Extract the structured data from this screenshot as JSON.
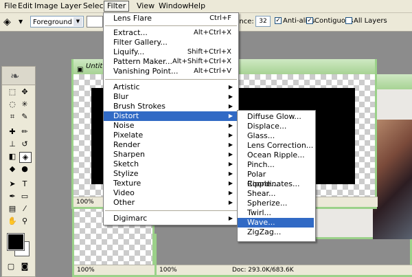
{
  "menubar": {
    "items": [
      "File",
      "Edit",
      "Image",
      "Layer",
      "Select",
      "Filter",
      "View",
      "Window",
      "Help"
    ],
    "active": "Filter"
  },
  "options": {
    "fill_source": "Foreground",
    "tolerance_label": "erance:",
    "tolerance_value": "32",
    "anti_alias_label": "Anti-alias",
    "anti_alias_checked": true,
    "contiguous_label": "Contiguous",
    "contiguous_checked": true,
    "all_layers_label": "All Layers",
    "all_layers_checked": false
  },
  "windows": {
    "doc1_title": "Untit",
    "doc1_zoom": "100%",
    "doc2_zoom": "100%",
    "doc3_zoom": "100%",
    "doc_size": "Doc: 293.0K/683.6K"
  },
  "filter_menu": {
    "top": [
      {
        "label": "Lens Flare",
        "shortcut": "Ctrl+F"
      }
    ],
    "group1": [
      {
        "label": "Extract...",
        "shortcut": "Alt+Ctrl+X"
      },
      {
        "label": "Filter Gallery...",
        "shortcut": ""
      },
      {
        "label": "Liquify...",
        "shortcut": "Shift+Ctrl+X"
      },
      {
        "label": "Pattern Maker...",
        "shortcut": "Alt+Shift+Ctrl+X"
      },
      {
        "label": "Vanishing Point...",
        "shortcut": "Alt+Ctrl+V"
      }
    ],
    "group2": [
      "Artistic",
      "Blur",
      "Brush Strokes",
      "Distort",
      "Noise",
      "Pixelate",
      "Render",
      "Sharpen",
      "Sketch",
      "Stylize",
      "Texture",
      "Video",
      "Other"
    ],
    "group3": [
      "Digimarc"
    ],
    "highlighted": "Distort"
  },
  "distort_menu": {
    "items": [
      "Diffuse Glow...",
      "Displace...",
      "Glass...",
      "Lens Correction...",
      "Ocean Ripple...",
      "Pinch...",
      "Polar Coordinates...",
      "Ripple...",
      "Shear...",
      "Spherize...",
      "Twirl...",
      "Wave...",
      "ZigZag..."
    ],
    "highlighted": "Wave..."
  },
  "colors": {
    "menu_highlight": "#316ac5",
    "foreground": "#000000",
    "background": "#ffffff",
    "window_frame": "#9bd189"
  }
}
